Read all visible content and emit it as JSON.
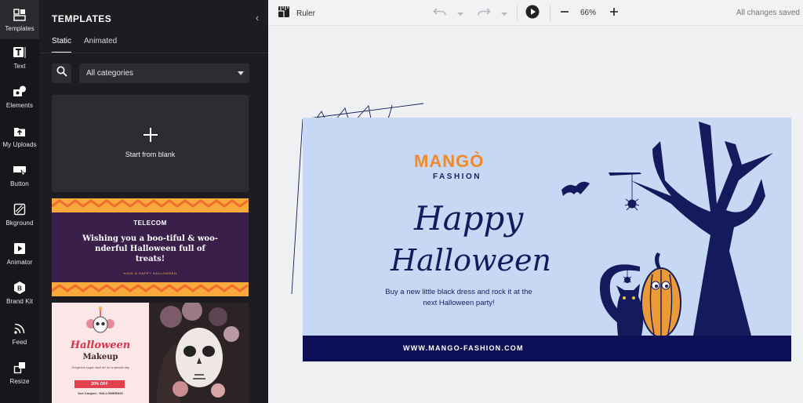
{
  "rail": {
    "items": [
      {
        "label": "Templates",
        "icon": "templates-icon"
      },
      {
        "label": "Text",
        "icon": "text-icon"
      },
      {
        "label": "Elements",
        "icon": "elements-icon"
      },
      {
        "label": "My Uploads",
        "icon": "upload-icon"
      },
      {
        "label": "Button",
        "icon": "button-icon"
      },
      {
        "label": "Bkground",
        "icon": "background-icon"
      },
      {
        "label": "Animator",
        "icon": "animator-icon"
      },
      {
        "label": "Brand Kit",
        "icon": "brand-kit-icon"
      },
      {
        "label": "Feed",
        "icon": "feed-icon"
      },
      {
        "label": "Resize",
        "icon": "resize-icon"
      }
    ]
  },
  "panel": {
    "title": "TEMPLATES",
    "tabs": [
      "Static",
      "Animated"
    ],
    "category_value": "All categories",
    "blank_label": "Start from blank",
    "templates": [
      {
        "brand": "TELECOM",
        "headline": "Wishing you a boo-tiful & woo-nderful Halloween full of treats!",
        "sub": "HAVE A HAPPY HALLOWEEN"
      },
      {
        "title": "Halloween",
        "subtitle": "Makeup",
        "desc": "Gorgeous sugar skull art for a special day",
        "button": "20% OFF",
        "coupon": "Use Coupon : HALLOWEEN20"
      }
    ]
  },
  "toolbar": {
    "ruler_label": "Ruler",
    "zoom": "66%",
    "status": "All changes saved"
  },
  "design": {
    "logo": "MANGÒ",
    "logo_sub": "FASHION",
    "headline_1": "Happy",
    "headline_2": "Halloween",
    "body": "Buy a new little black dress and rock it at the next Halloween party!",
    "url": "WWW.MANGO-FASHION.COM"
  },
  "colors": {
    "rail_bg": "#17171b",
    "panel_bg": "#1d1d21",
    "design_bg": "#c7d8f4",
    "navy": "#141a5c",
    "orange": "#ef8a2c"
  }
}
